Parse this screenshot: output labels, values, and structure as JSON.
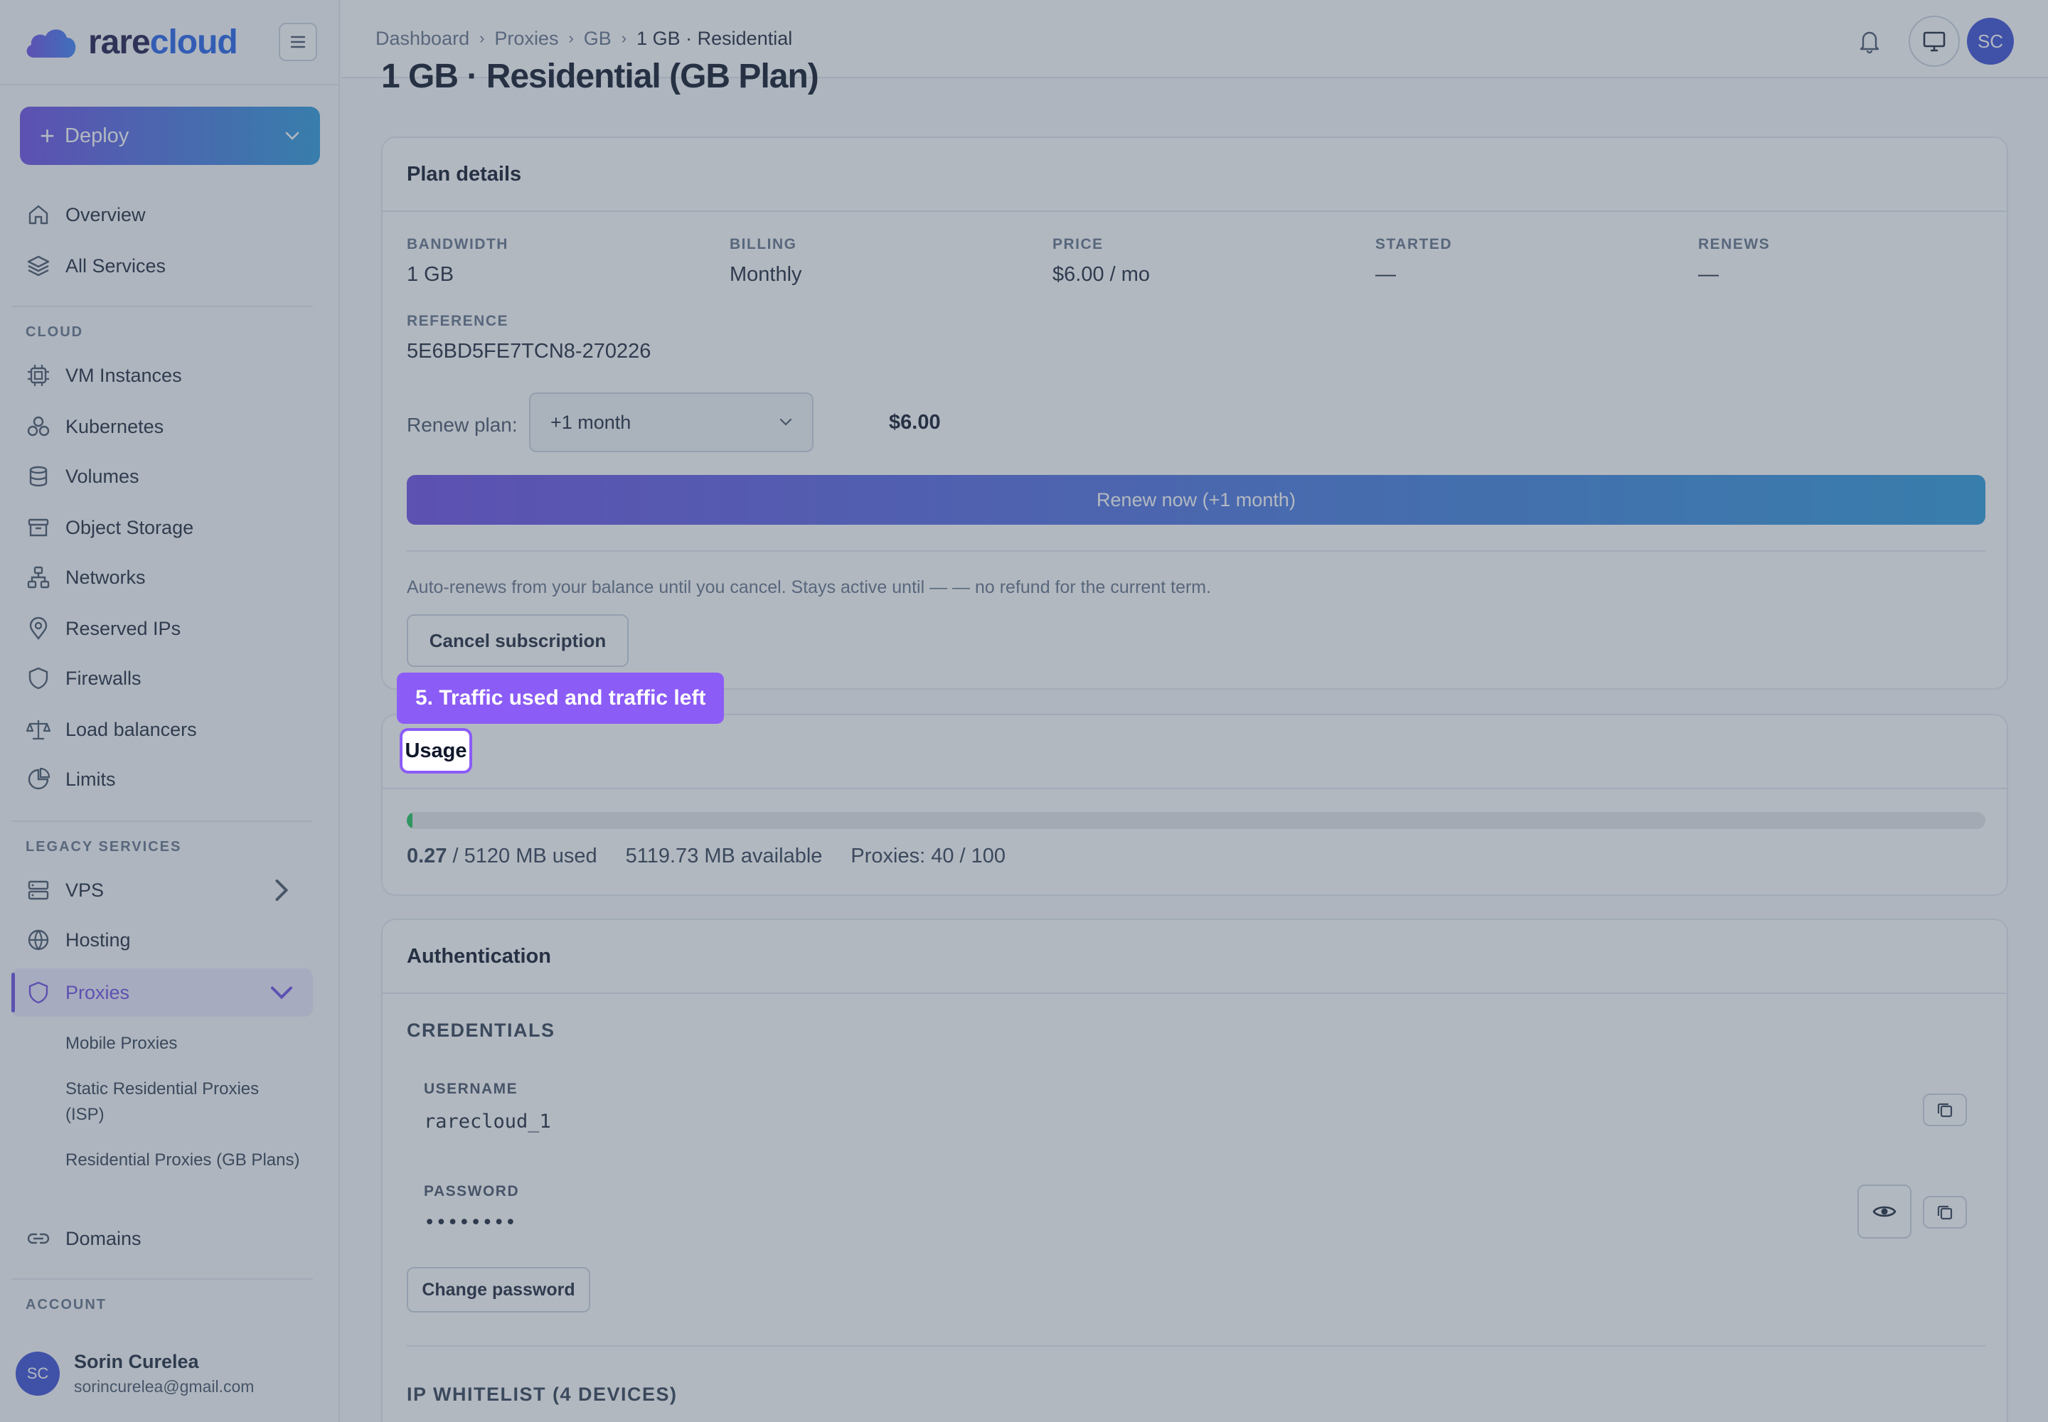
{
  "app": {
    "logo_part1": "rare",
    "logo_part2": "cloud",
    "brand_colors": {
      "primary": "#6d4ee6",
      "secondary": "#2d9bdc"
    }
  },
  "sidebar": {
    "deploy_label": "Deploy",
    "top_items": [
      {
        "label": "Overview",
        "icon": "home-icon"
      },
      {
        "label": "All Services",
        "icon": "layers-icon"
      }
    ],
    "cloud_label": "CLOUD",
    "cloud_items": [
      {
        "label": "VM Instances",
        "icon": "cpu-icon"
      },
      {
        "label": "Kubernetes",
        "icon": "kubernetes-icon"
      },
      {
        "label": "Volumes",
        "icon": "database-icon"
      },
      {
        "label": "Object Storage",
        "icon": "archive-icon"
      },
      {
        "label": "Networks",
        "icon": "network-icon"
      },
      {
        "label": "Reserved IPs",
        "icon": "map-pin-icon"
      },
      {
        "label": "Firewalls",
        "icon": "shield-icon"
      },
      {
        "label": "Load balancers",
        "icon": "scale-icon"
      },
      {
        "label": "Limits",
        "icon": "pie-chart-icon"
      }
    ],
    "legacy_label": "LEGACY SERVICES",
    "legacy_items": [
      {
        "label": "VPS",
        "icon": "server-icon"
      },
      {
        "label": "Hosting",
        "icon": "globe-icon"
      },
      {
        "label": "Proxies",
        "icon": "shield-icon"
      }
    ],
    "proxies_sub": [
      "Mobile Proxies",
      "Static Residential Proxies (ISP)",
      "Residential Proxies (GB Plans)"
    ],
    "domains_label": "Domains",
    "account_label": "ACCOUNT",
    "user": {
      "initials": "SC",
      "name": "Sorin Curelea",
      "email": "sorincurelea@gmail.com"
    }
  },
  "header": {
    "breadcrumbs": [
      "Dashboard",
      "Proxies",
      "GB",
      "1 GB · Residential"
    ],
    "avatar_initials": "SC"
  },
  "page": {
    "title": "1 GB · Residential (GB Plan)"
  },
  "plan": {
    "heading": "Plan details",
    "fields": [
      {
        "label": "BANDWIDTH",
        "value": "1 GB"
      },
      {
        "label": "BILLING",
        "value": "Monthly"
      },
      {
        "label": "PRICE",
        "value": "$6.00 / mo"
      },
      {
        "label": "STARTED",
        "value": "—"
      },
      {
        "label": "RENEWS",
        "value": "—"
      }
    ],
    "reference_label": "REFERENCE",
    "reference_value": "5E6BD5FE7TCN8-270226",
    "renew_label": "Renew plan:",
    "renew_option": "+1 month",
    "renew_price": "$6.00",
    "renew_button": "Renew now (+1 month)",
    "auto_note": "Auto-renews from your balance until you cancel. Stays active until — — no refund for the current term.",
    "cancel_button": "Cancel subscription"
  },
  "usage": {
    "heading": "Usage",
    "used": "0.27",
    "used_suffix": " / 5120 MB used",
    "available": "5119.73 MB available",
    "proxies": "Proxies: 40 / 100",
    "used_fraction": 5.27e-05
  },
  "auth": {
    "heading": "Authentication",
    "credentials_label": "CREDENTIALS",
    "username_label": "USERNAME",
    "username_value": "rarecloud_1",
    "password_label": "PASSWORD",
    "password_value": "••••••••",
    "change_password": "Change password",
    "whitelist_label": "IP WHITELIST (4 DEVICES)"
  },
  "tour": {
    "tip_text": "5. Traffic used and traffic left"
  }
}
